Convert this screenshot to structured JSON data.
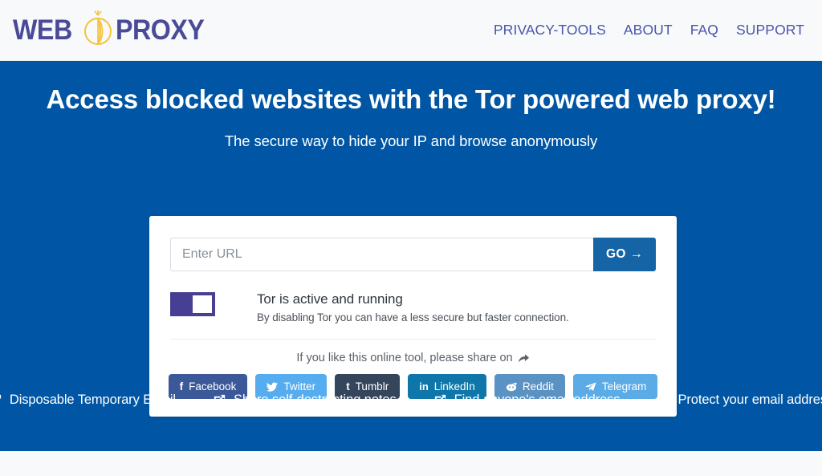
{
  "header": {
    "logo": {
      "word_first": "WEB",
      "word_second": "PROXY",
      "icon": "tor-onion-icon",
      "color": "#4a4a96",
      "icon_color": "#f5c33b"
    },
    "nav": [
      {
        "label": "PRIVACY-TOOLS",
        "name": "nav-privacy-tools"
      },
      {
        "label": "ABOUT",
        "name": "nav-about"
      },
      {
        "label": "FAQ",
        "name": "nav-faq"
      },
      {
        "label": "SUPPORT",
        "name": "nav-support"
      }
    ],
    "nav_color": "#4a55a8",
    "background": "#f7f9fb"
  },
  "hero": {
    "background": "#0056a4",
    "title": "Access blocked websites with the Tor powered web proxy!",
    "subtitle": "The secure way to hide your IP and browse anonymously"
  },
  "card": {
    "url_form": {
      "input_value": "",
      "input_placeholder": "Enter URL",
      "go_label": "GO",
      "go_arrow": "→",
      "go_color": "#1565a6"
    },
    "tor_toggle": {
      "state": "on",
      "title": "Tor is active and running",
      "description": "By disabling Tor you can have a less secure but faster connection.",
      "color": "#473f94"
    },
    "share": {
      "prompt": "If you like this online tool, please share on",
      "prompt_icon": "share-arrow-icon",
      "buttons": [
        {
          "label": "Facebook",
          "icon": "facebook-icon",
          "glyph": "f",
          "color": "#3b5998",
          "name": "share-facebook-button"
        },
        {
          "label": "Twitter",
          "icon": "twitter-icon",
          "glyph": "🐦",
          "color": "#55acee",
          "name": "share-twitter-button"
        },
        {
          "label": "Tumblr",
          "icon": "tumblr-icon",
          "glyph": "t",
          "color": "#35465c",
          "name": "share-tumblr-button"
        },
        {
          "label": "LinkedIn",
          "icon": "linkedin-icon",
          "glyph": "in",
          "color": "#0e76a8",
          "name": "share-linkedin-button"
        },
        {
          "label": "Reddit",
          "icon": "reddit-icon",
          "glyph": "◉",
          "color": "#5b92c4",
          "name": "share-reddit-button"
        },
        {
          "label": "Telegram",
          "icon": "telegram-icon",
          "glyph": "➤",
          "color": "#5aabe6",
          "name": "share-telegram-button"
        }
      ]
    }
  },
  "footer": {
    "links": [
      {
        "label": "Disposable Temporary Email",
        "icon": "external-link-icon",
        "name": "footer-link-disposable-email"
      },
      {
        "label": "Share self-destructing notes",
        "icon": "external-link-icon",
        "name": "footer-link-self-destructing-notes"
      },
      {
        "label": "Find anyone's email address",
        "icon": "external-link-icon",
        "name": "footer-link-find-email"
      },
      {
        "label": "Protect your email address",
        "icon": "external-link-icon",
        "name": "footer-link-protect-email"
      }
    ]
  }
}
